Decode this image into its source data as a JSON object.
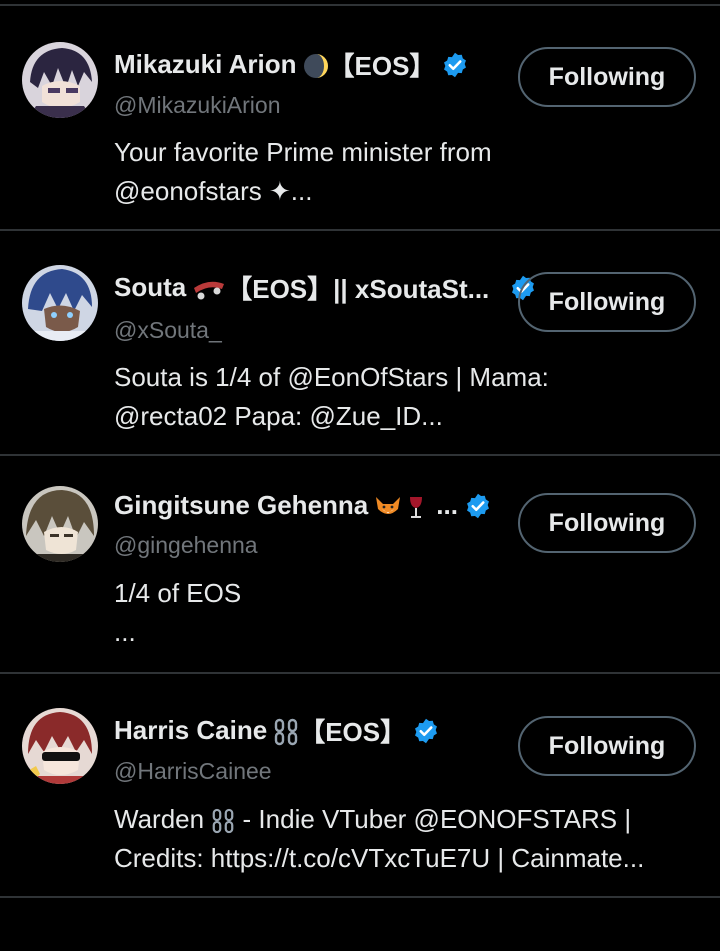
{
  "accent_color": "#1d9bf0",
  "users": [
    {
      "name": "Mikazuki Arion",
      "name_suffix": "【EOS】",
      "name_icon": "crescent-moon-icon",
      "handle": "@MikazukiArion",
      "bio_line1": "Your favorite Prime minister from",
      "bio_line2": "@eonofstars ✦...",
      "follow_label": "Following"
    },
    {
      "name": "Souta",
      "name_suffix": "【EOS】|| xSoutaSt...",
      "name_icon": "skateboard-icon",
      "handle": "@xSouta_",
      "bio_line1": "Souta is 1/4 of @EonOfStars | Mama:",
      "bio_line2": "@recta02 Papa: @Zue_ID...",
      "follow_label": "Following"
    },
    {
      "name": "Gingitsune Gehenna",
      "name_suffix": "...",
      "name_icon": "fox-wine-icon",
      "handle": "@gingehenna",
      "bio_line1": "1/4 of EOS",
      "bio_line2": "...",
      "follow_label": "Following"
    },
    {
      "name": "Harris Caine",
      "name_suffix": "【EOS】",
      "name_icon": "chains-icon",
      "handle": "@HarrisCainee",
      "bio_line1_a": "Warden",
      "bio_line1_b": "- Indie VTuber @EONOFSTARS |",
      "bio_line2": "Credits: https://t.co/cVTxcTuE7U | Cainmate...",
      "follow_label": "Following"
    }
  ]
}
